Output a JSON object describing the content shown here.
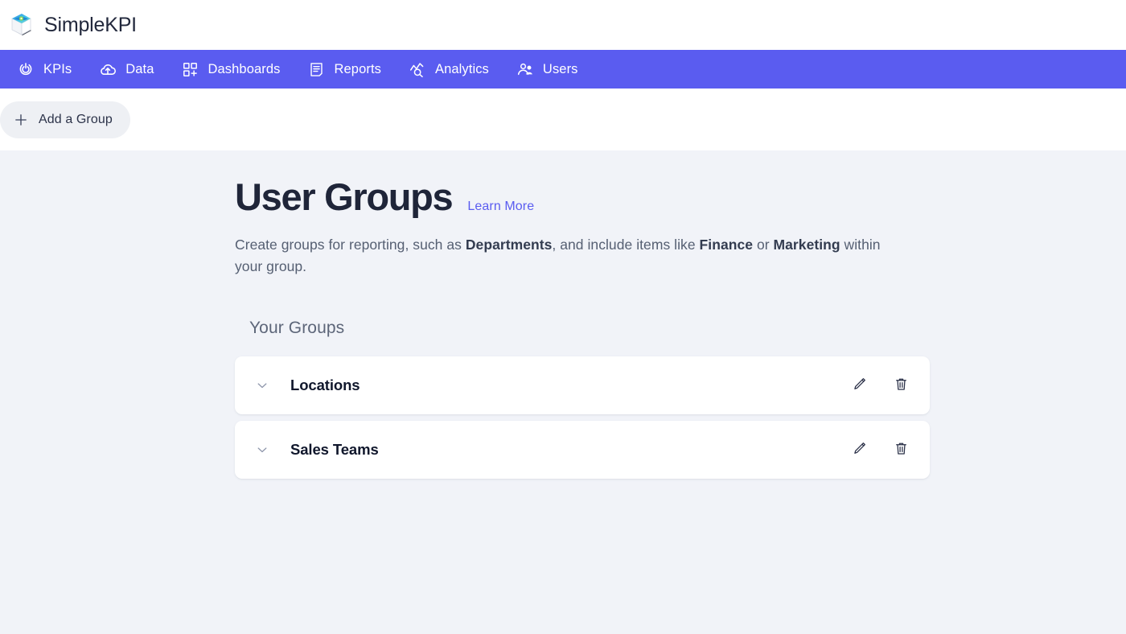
{
  "brand": {
    "name": "SimpleKPI",
    "logo_icon": "cube-logo-icon"
  },
  "nav": {
    "items": [
      {
        "label": "KPIs",
        "icon": "power-circle-icon"
      },
      {
        "label": "Data",
        "icon": "cloud-upload-icon"
      },
      {
        "label": "Dashboards",
        "icon": "dashboard-grid-icon"
      },
      {
        "label": "Reports",
        "icon": "document-lines-icon"
      },
      {
        "label": "Analytics",
        "icon": "chart-search-icon"
      },
      {
        "label": "Users",
        "icon": "users-icon"
      }
    ]
  },
  "toolbar": {
    "add_group_label": "Add a Group",
    "add_group_icon": "plus-icon"
  },
  "main": {
    "title": "User Groups",
    "learn_more_label": "Learn More",
    "description": {
      "part1": "Create groups for reporting, such as ",
      "bold1": "Departments",
      "part2": ", and include items like ",
      "bold2": "Finance",
      "part3": " or ",
      "bold3": "Marketing",
      "part4": " within your group."
    },
    "section_heading": "Your Groups",
    "groups": [
      {
        "name": "Locations",
        "expand_icon": "chevron-down-icon",
        "edit_icon": "pencil-icon",
        "delete_icon": "trash-icon"
      },
      {
        "name": "Sales Teams",
        "expand_icon": "chevron-down-icon",
        "edit_icon": "pencil-icon",
        "delete_icon": "trash-icon"
      }
    ]
  },
  "colors": {
    "nav_background": "#5a5cf0",
    "accent": "#5a5cf0",
    "page_background": "#f1f3f8",
    "card_background": "#ffffff",
    "title_text": "#1f2539"
  }
}
